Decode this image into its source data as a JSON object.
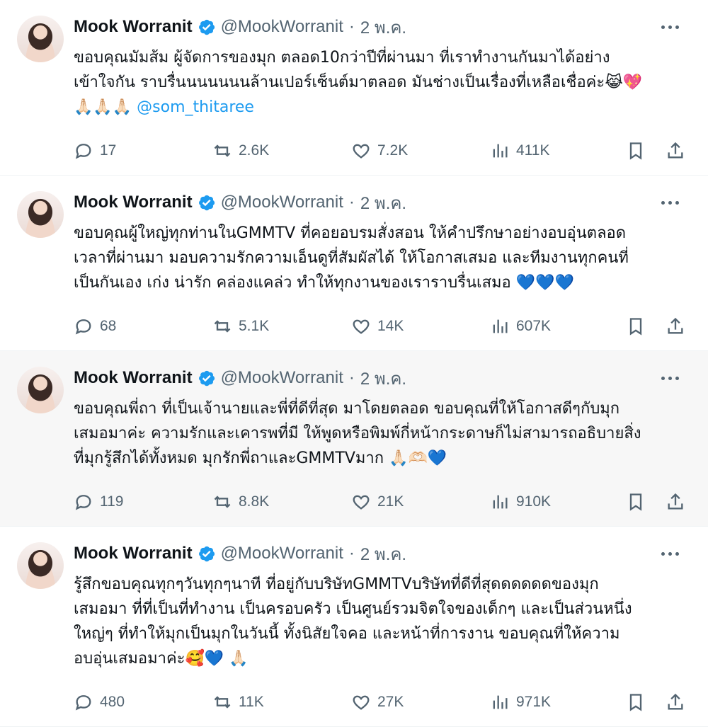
{
  "tweets": [
    {
      "author": "Mook Worranit",
      "handle": "@MookWorranit",
      "separator": "·",
      "date": "2 พ.ค.",
      "text_before_mention": "ขอบคุณมัมส้ม ผู้จัดการของมุก ตลอด10กว่าปีที่ผ่านมา ที่เราทำงานกันมาได้อย่าง\nเข้าใจกัน ราบรื่นนนนนนนล้านเปอร์เซ็นต์มาตลอด มันช่างเป็นเรื่องที่เหลือเชื่อค่ะ😹💖\n🙏🏻🙏🏻🙏🏻 ",
      "mention": "@som_thitaree",
      "replies": "17",
      "reposts": "2.6K",
      "likes": "7.2K",
      "views": "411K"
    },
    {
      "author": "Mook Worranit",
      "handle": "@MookWorranit",
      "separator": "·",
      "date": "2 พ.ค.",
      "text_before_mention": "ขอบคุณผู้ใหญ่ทุกท่านในGMMTV ที่คอยอบรมสั่งสอน ให้คำปรึกษาอย่างอบอุ่นตลอด\nเวลาที่ผ่านมา มอบความรักความเอ็นดูที่สัมผัสได้ ให้โอกาสเสมอ และทีมงานทุกคนที่\nเป็นกันเอง เก่ง น่ารัก คล่องแคล่ว ทำให้ทุกงานของเราราบรื่นเสมอ 💙💙💙",
      "mention": "",
      "replies": "68",
      "reposts": "5.1K",
      "likes": "14K",
      "views": "607K"
    },
    {
      "author": "Mook Worranit",
      "handle": "@MookWorranit",
      "separator": "·",
      "date": "2 พ.ค.",
      "text_before_mention": "ขอบคุณพี่ถา ที่เป็นเจ้านายและพี่ที่ดีที่สุด มาโดยตลอด ขอบคุณที่ให้โอกาสดีๆกับมุก\nเสมอมาค่ะ ความรักและเคารพที่มี ให้พูดหรือพิมพ์กี่หน้ากระดาษก็ไม่สามารถอธิบายสิ่ง\nที่มุกรู้สึกได้ทั้งหมด มุกรักพี่ถาและGMMTVมาก 🙏🏻🫶🏻💙",
      "mention": "",
      "replies": "119",
      "reposts": "8.8K",
      "likes": "21K",
      "views": "910K"
    },
    {
      "author": "Mook Worranit",
      "handle": "@MookWorranit",
      "separator": "·",
      "date": "2 พ.ค.",
      "text_before_mention": "รู้สึกขอบคุณทุกๆวันทุกๆนาที ที่อยู่กับบริษัทGMMTVบริษัทที่ดีที่สุดดดดดดของมุก\nเสมอมา ที่ที่เป็นที่ทำงาน เป็นครอบครัว เป็นศูนย์รวมจิตใจของเด็กๆ และเป็นส่วนหนึ่ง\nใหญ่ๆ ที่ทำให้มุกเป็นมุกในวันนี้ ทั้งนิสัยใจคอ และหน้าที่การงาน ขอบคุณที่ให้ความ\nอบอุ่นเสมอมาค่ะ🥰💙 🙏🏻",
      "mention": "",
      "replies": "480",
      "reposts": "11K",
      "likes": "27K",
      "views": "971K"
    }
  ],
  "icons": {
    "verified": "verified-badge-icon",
    "more": "more-icon",
    "reply": "reply-icon",
    "repost": "repost-icon",
    "like": "heart-icon",
    "views": "views-icon",
    "bookmark": "bookmark-icon",
    "share": "share-icon"
  },
  "colors": {
    "text": "#0f1419",
    "muted": "#536471",
    "link": "#1d9bf0",
    "verified": "#1d9bf0",
    "hover_background": "#f7f7f7"
  }
}
